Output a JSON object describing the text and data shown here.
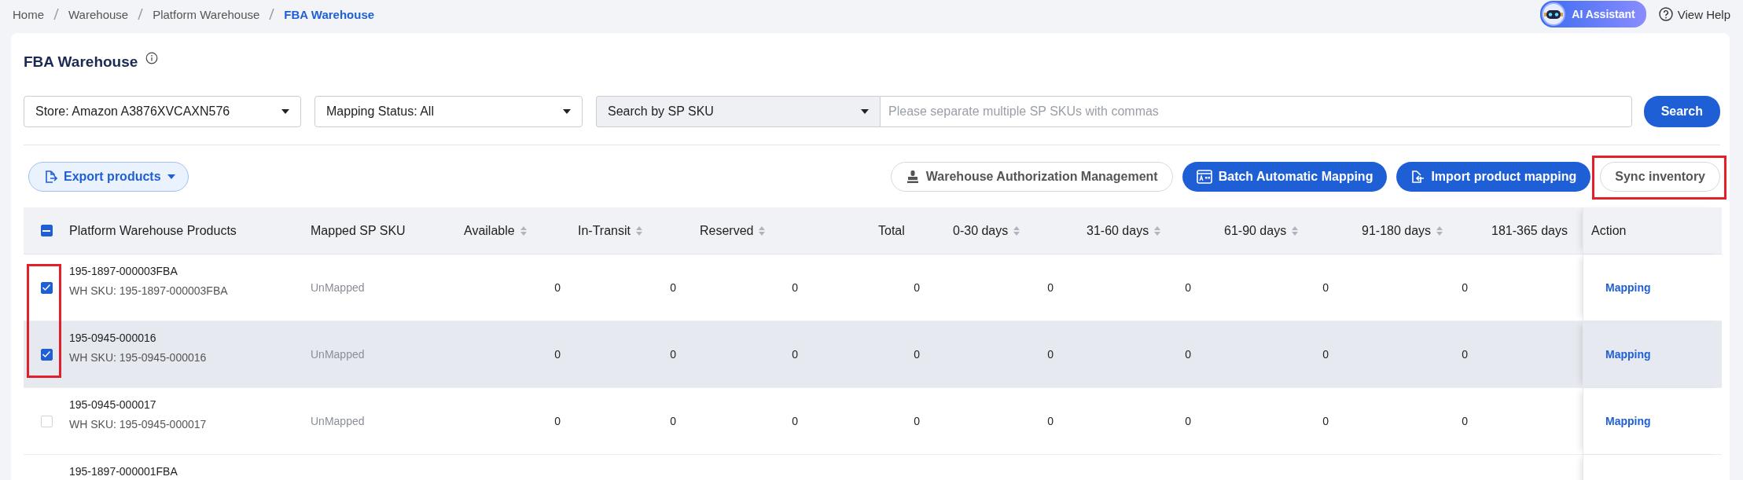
{
  "breadcrumb": [
    {
      "label": "Home",
      "current": false
    },
    {
      "label": "Warehouse",
      "current": false
    },
    {
      "label": "Platform Warehouse",
      "current": false
    },
    {
      "label": "FBA Warehouse",
      "current": true
    }
  ],
  "top_actions": {
    "ai_assistant": "AI Assistant",
    "help": "View Help"
  },
  "title": "FBA Warehouse",
  "filters": {
    "store": "Store: Amazon A3876XVCAXN576",
    "mapping_status": "Mapping Status: All",
    "search_type": "Search by SP SKU",
    "search_placeholder": "Please separate multiple SP SKUs with commas",
    "search_button": "Search"
  },
  "toolbar": {
    "export": "Export products",
    "actions": [
      {
        "label": "Warehouse Authorization Management",
        "kind": "outline",
        "annotated": false
      },
      {
        "label": "Batch Automatic Mapping",
        "kind": "primary",
        "annotated": false
      },
      {
        "label": "Import product mapping",
        "kind": "primary",
        "annotated": false
      },
      {
        "label": "Sync inventory",
        "kind": "outline",
        "annotated": true
      }
    ]
  },
  "table": {
    "header_checkbox": {
      "indeterminate": true
    },
    "columns": [
      {
        "label": "Platform Warehouse Products",
        "sortable": false
      },
      {
        "label": "Mapped SP SKU",
        "sortable": false
      },
      {
        "label": "Available",
        "sortable": true
      },
      {
        "label": "In-Transit",
        "sortable": true
      },
      {
        "label": "Reserved",
        "sortable": true
      },
      {
        "label": "Total",
        "sortable": false
      },
      {
        "label": "0-30 days",
        "sortable": true
      },
      {
        "label": "31-60 days",
        "sortable": true
      },
      {
        "label": "61-90 days",
        "sortable": true
      },
      {
        "label": "91-180 days",
        "sortable": true
      },
      {
        "label": "181-365 days",
        "sortable": false
      },
      {
        "label": "Action",
        "sortable": false
      }
    ],
    "rows": [
      {
        "product": "195-1897-000003FBA",
        "wh_sku": "WH SKU: 195-1897-000003FBA",
        "mapped": "UnMapped",
        "values": [
          "0",
          "0",
          "0",
          "0",
          "0",
          "0",
          "0",
          "0"
        ],
        "action": "Mapping",
        "checked": true,
        "highlighted": false,
        "annotated": true
      },
      {
        "product": "195-0945-000016",
        "wh_sku": "WH SKU: 195-0945-000016",
        "mapped": "UnMapped",
        "values": [
          "0",
          "0",
          "0",
          "0",
          "0",
          "0",
          "0",
          "0"
        ],
        "action": "Mapping",
        "checked": true,
        "highlighted": true,
        "annotated": true
      },
      {
        "product": "195-0945-000017",
        "wh_sku": "WH SKU: 195-0945-000017",
        "mapped": "UnMapped",
        "values": [
          "0",
          "0",
          "0",
          "0",
          "0",
          "0",
          "0",
          "0"
        ],
        "action": "Mapping",
        "checked": false,
        "highlighted": false,
        "annotated": false
      },
      {
        "product": "195-1897-000001FBA",
        "highlighted": false
      }
    ]
  }
}
